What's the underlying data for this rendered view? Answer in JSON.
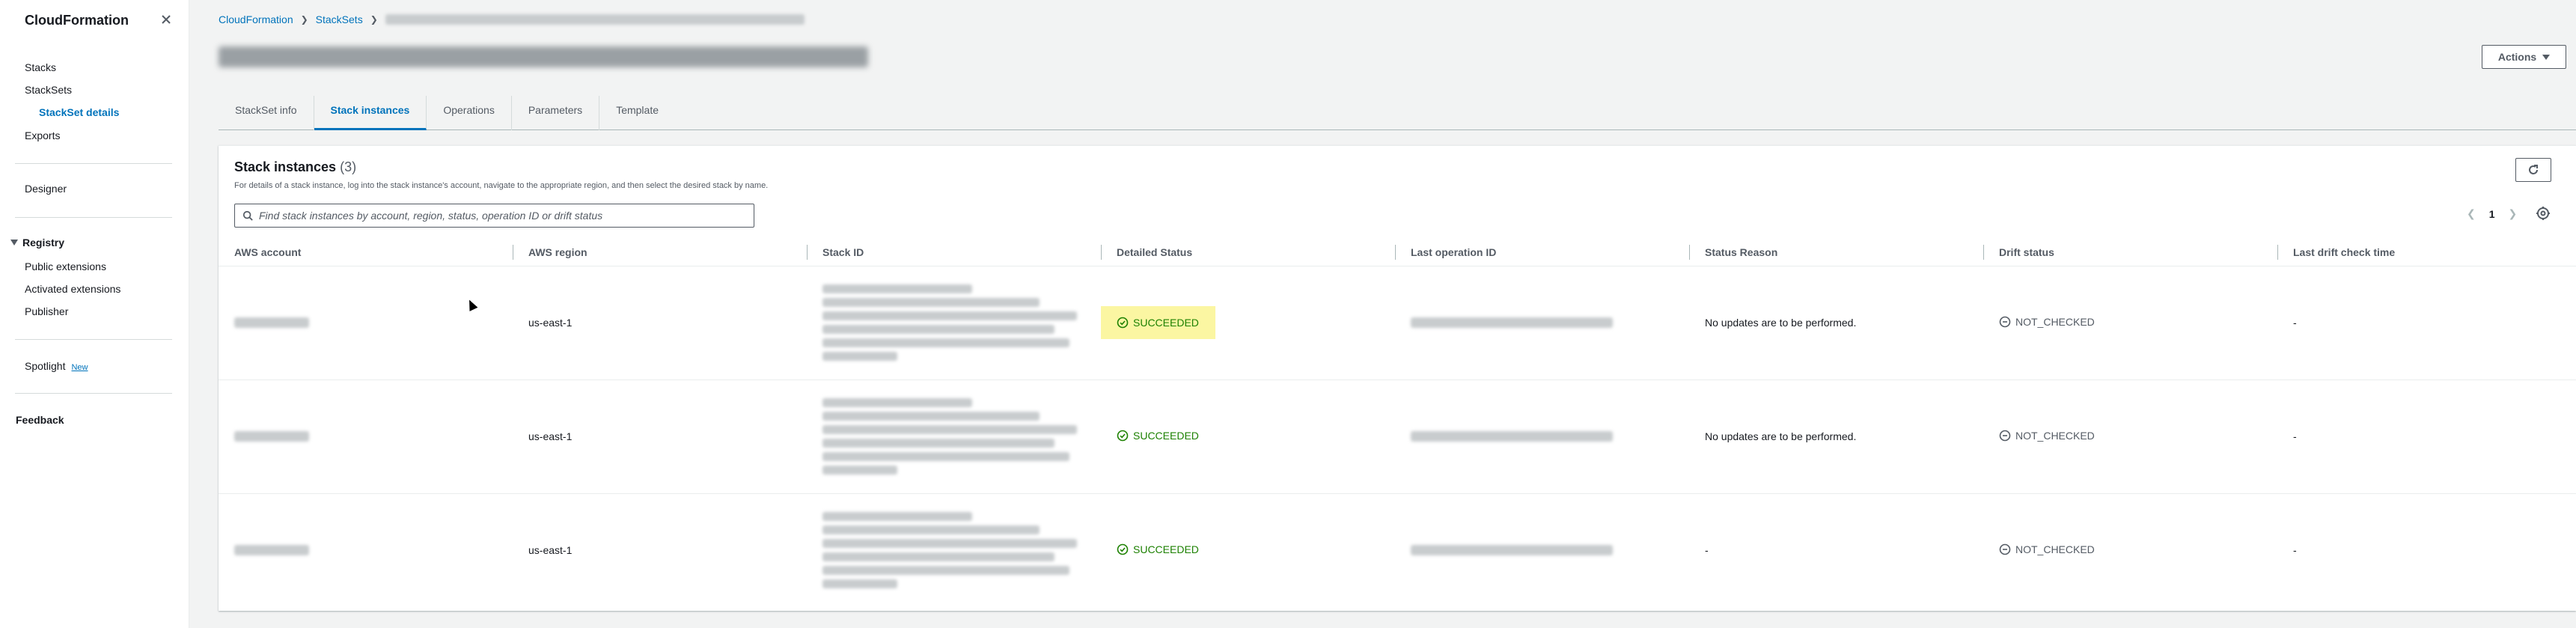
{
  "sidebar": {
    "title": "CloudFormation",
    "items": [
      {
        "label": "Stacks"
      },
      {
        "label": "StackSets"
      },
      {
        "label": "StackSet details"
      },
      {
        "label": "Exports"
      }
    ],
    "designer": "Designer",
    "registry": {
      "label": "Registry",
      "items": [
        {
          "label": "Public extensions"
        },
        {
          "label": "Activated extensions"
        },
        {
          "label": "Publisher"
        }
      ]
    },
    "spotlight": {
      "label": "Spotlight",
      "badge": "New"
    },
    "feedback": "Feedback"
  },
  "breadcrumb": [
    "CloudFormation",
    "StackSets"
  ],
  "actions_label": "Actions",
  "tabs": [
    {
      "label": "StackSet info"
    },
    {
      "label": "Stack instances"
    },
    {
      "label": "Operations"
    },
    {
      "label": "Parameters"
    },
    {
      "label": "Template"
    }
  ],
  "panel": {
    "title": "Stack instances",
    "count": "(3)",
    "description": "For details of a stack instance, log into the stack instance's account, navigate to the appropriate region, and then select the desired stack by name.",
    "search_placeholder": "Find stack instances by account, region, status, operation ID or drift status",
    "page": "1"
  },
  "columns": [
    "AWS account",
    "AWS region",
    "Stack ID",
    "Detailed Status",
    "Last operation ID",
    "Status Reason",
    "Drift status",
    "Last drift check time"
  ],
  "rows": [
    {
      "region": "us-east-1",
      "status": "SUCCEEDED",
      "reason": "No updates are to be performed.",
      "drift": "NOT_CHECKED",
      "last_check": "-"
    },
    {
      "region": "us-east-1",
      "status": "SUCCEEDED",
      "reason": "No updates are to be performed.",
      "drift": "NOT_CHECKED",
      "last_check": "-"
    },
    {
      "region": "us-east-1",
      "status": "SUCCEEDED",
      "reason": "-",
      "drift": "NOT_CHECKED",
      "last_check": "-"
    }
  ],
  "colors": {
    "link": "#0073bb",
    "success": "#1d8102",
    "highlight": "#fbf6a2"
  }
}
